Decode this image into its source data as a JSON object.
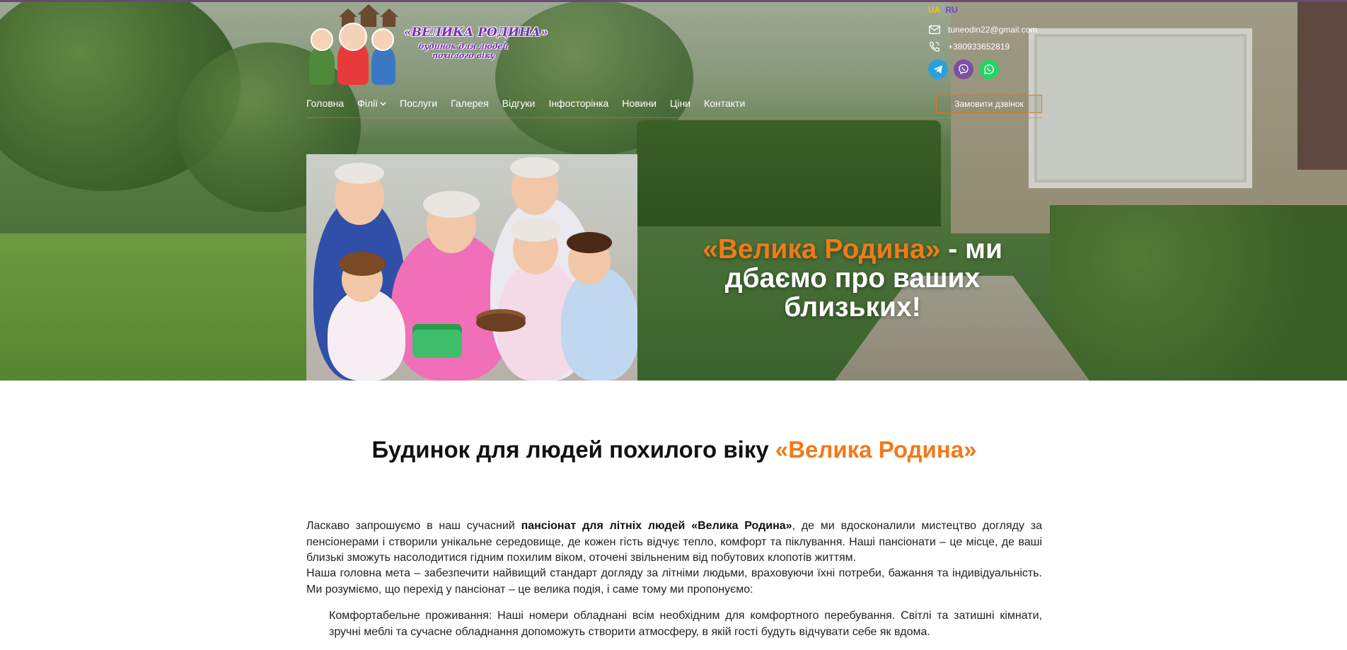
{
  "header": {
    "logo": {
      "name": "«ВЕЛИКА РОДИНА»",
      "tagline": "будинок для людей похилого віку"
    },
    "nav": [
      {
        "label": "Головна"
      },
      {
        "label": "Філії",
        "has_dropdown": true
      },
      {
        "label": "Послуги"
      },
      {
        "label": "Галерея"
      },
      {
        "label": "Відгуки"
      },
      {
        "label": "Інфосторінка"
      },
      {
        "label": "Новини"
      },
      {
        "label": "Ціни"
      },
      {
        "label": "Контакти"
      }
    ],
    "languages": {
      "ua": "UA",
      "ru": "RU"
    },
    "email": "tuneodin22@gmail.com",
    "phone": "+380933652819",
    "social": [
      "telegram-icon",
      "viber-icon",
      "whatsapp-icon"
    ],
    "call_button": "Замовити дзвінок"
  },
  "hero": {
    "brand": "«Велика Родина»",
    "tagline": " - ми дбаємо про ваших близьких!"
  },
  "main": {
    "heading_text": "Будинок для людей похилого віку ",
    "heading_accent": "«Велика Родина»",
    "p1_start": "Ласкаво запрошуємо в наш сучасний ",
    "p1_bold": "пансіонат для літніх людей «Велика Родина»",
    "p1_end": ", де ми вдосконалили мистецтво догляду за пенсіонерами і створили унікальне середовище, де кожен гість відчує тепло, комфорт та піклування. Наші пансіонати – це місце, де ваші близькі зможуть насолодитися гідним похилим віком, оточені звільненим від побутових клопотів життям.",
    "p2": "Наша головна мета – забезпечити найвищий стандарт догляду за літніми людьми, враховуючи їхні потреби, бажання та індивідуальність. Ми розуміємо, що перехід у пансіонат – це велика подія, і саме тому ми пропонуємо:",
    "p3": "Комфортабельне проживання: Наші номери обладнані всім необхідним для комфортного перебування. Світлі та затишні кімнати, зручні меблі та сучасне обладнання допоможуть створити атмосферу, в якій гості будуть відчувати себе як вдома."
  },
  "colors": {
    "accent": "#f07a1a",
    "logo_purple": "#7a2bb8",
    "lang_active": "#f4c400",
    "lang_inactive": "#6b46c1"
  }
}
